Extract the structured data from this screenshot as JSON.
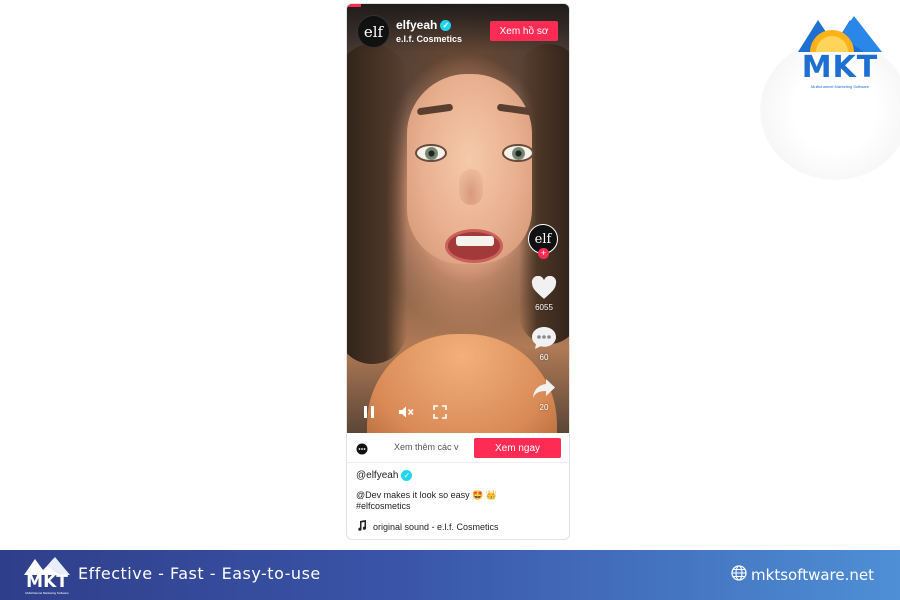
{
  "embed": {
    "author": {
      "username": "elfyeah",
      "display_name": "e.l.f. Cosmetics",
      "avatar_text": "elf",
      "verified_icon": "verified-badge-icon"
    },
    "profile_button": "Xem hồ sơ",
    "actions": {
      "likes": "6055",
      "comments": "60",
      "shares": "20"
    },
    "controls": {
      "pause_icon": "pause-icon",
      "mute_icon": "volume-muted-icon",
      "fullscreen_icon": "fullscreen-icon"
    },
    "promo": {
      "text": "Xem thêm các v",
      "button": "Xem ngay"
    },
    "handle": "@elfyeah",
    "caption_line1": "@Dev makes it look so easy 🤩 👑",
    "caption_line2": "#elfcosmetics",
    "sound": "original sound - e.l.f. Cosmetics"
  },
  "brand": {
    "name": "MKT",
    "subtitle": "Multichannel Marketing Software"
  },
  "footer": {
    "logo_name": "MKT",
    "logo_sub": "Multichannel Marketing Software",
    "tagline": "Effective - Fast - Easy-to-use",
    "website": "mktsoftware.net"
  },
  "colors": {
    "tiktok_red": "#fe2c55",
    "verified": "#20d5ec",
    "brand_blue": "#1d6fd1",
    "footer_start": "#2f3e8a",
    "footer_end": "#4e8fd6"
  }
}
